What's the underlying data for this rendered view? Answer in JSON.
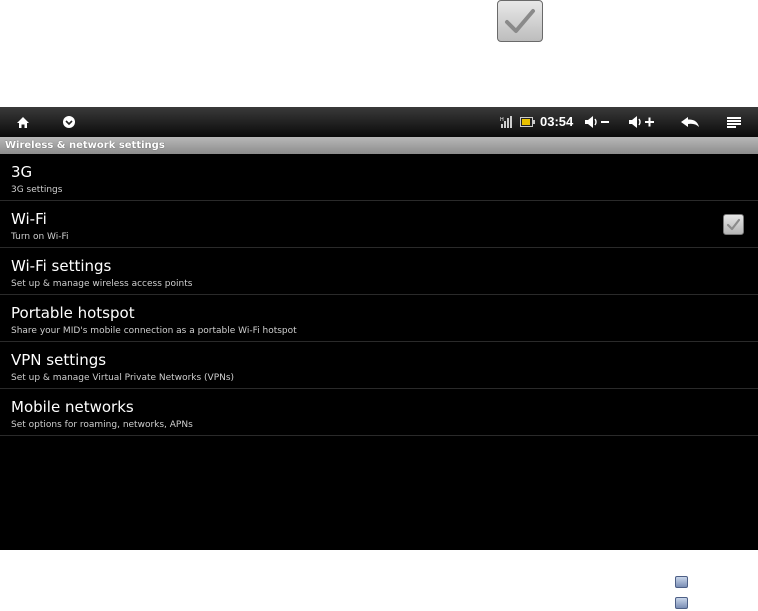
{
  "status_bar": {
    "time": "03:54",
    "icons": [
      "home-icon",
      "menu-down-icon",
      "signal-icon",
      "battery-icon",
      "volume-down-icon",
      "volume-up-icon",
      "back-icon",
      "menu-icon"
    ]
  },
  "section_header": "Wireless & network settings",
  "settings": [
    {
      "title": "3G",
      "summary": "3G settings",
      "has_checkbox": false
    },
    {
      "title": "Wi-Fi",
      "summary": "Turn on Wi-Fi",
      "has_checkbox": true,
      "checked": true
    },
    {
      "title": "Wi-Fi settings",
      "summary": "Set up & manage wireless access points",
      "has_checkbox": false
    },
    {
      "title": "Portable hotspot",
      "summary": "Share your MID's mobile connection as a portable Wi-Fi hotspot",
      "has_checkbox": false
    },
    {
      "title": "VPN settings",
      "summary": "Set up & manage Virtual Private Networks (VPNs)",
      "has_checkbox": false
    },
    {
      "title": "Mobile networks",
      "summary": "Set options for roaming, networks, APNs",
      "has_checkbox": false
    }
  ],
  "colors": {
    "screen_bg": "#000000",
    "header_bg": "#a4a4a4",
    "text": "#ffffff",
    "summary_text": "#cfcfcf"
  }
}
